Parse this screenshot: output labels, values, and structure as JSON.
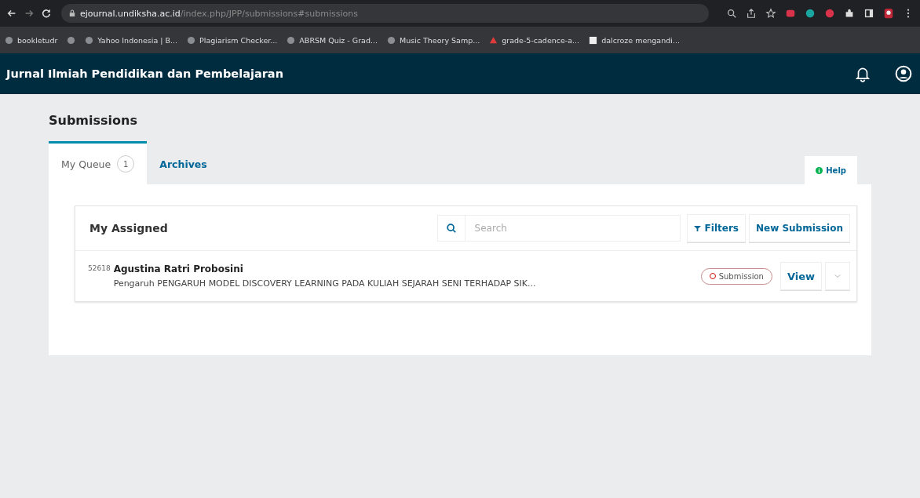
{
  "browser": {
    "url_host": "ejournal.undiksha.ac.id",
    "url_path": "/index.php/JPP/submissions#submissions",
    "bookmarks": [
      "bookletudr",
      "Yahoo Indonesia | B...",
      "Plagiarism Checker...",
      "ABRSM Quiz - Grad...",
      "Music Theory Samp...",
      "grade-5-cadence-a...",
      "dalcroze mengandi..."
    ]
  },
  "app": {
    "title": "Jurnal Ilmiah Pendidikan dan Pembelajaran"
  },
  "page_title": "Submissions",
  "tabs": [
    {
      "label": "My Queue",
      "count": "1",
      "selected": true
    },
    {
      "label": "Archives",
      "selected": false
    }
  ],
  "help": "Help",
  "list": {
    "title": "My Assigned",
    "search": {
      "placeholder": "Search"
    },
    "filters": "Filters",
    "new_submission": "New Submission",
    "items": [
      {
        "id": "52618",
        "author": "Agustina Ratri Probosini",
        "title": "Pengaruh PENGARUH MODEL DISCOVERY LEARNING PADA KULIAH SEJARAH SENI TERHADAP SIK...",
        "stage": "Submission",
        "action": "View"
      }
    ]
  }
}
